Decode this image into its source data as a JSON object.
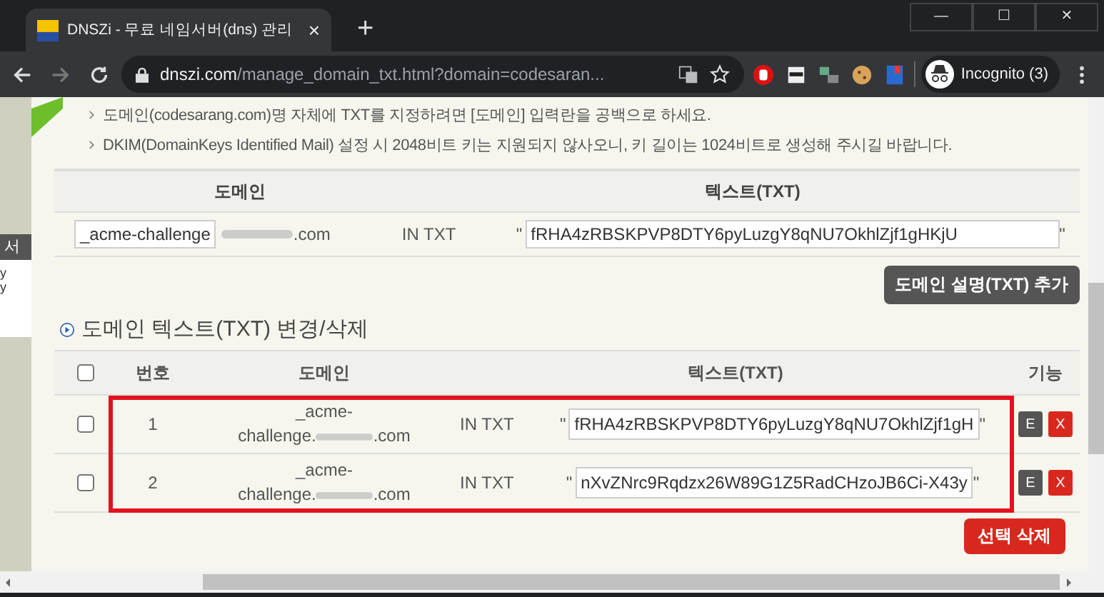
{
  "browser": {
    "tab_title": "DNSZi - 무료 네임서버(dns) 관리",
    "tab_close": "×",
    "new_tab": "+",
    "url_host": "dnszi.com",
    "url_path": "/manage_domain_txt.html?domain=codesaran...",
    "profile": "Incognito (3)",
    "window_buttons": [
      "—",
      "☐",
      "✕"
    ]
  },
  "side_fragment": {
    "label": "서",
    "lines": [
      "y",
      "y"
    ]
  },
  "notes": [
    "도메인(codesarang.com)명 자체에 TXT를 지정하려면 [도메인] 입력란을 공백으로 하세요.",
    "DKIM(DomainKeys Identified Mail) 설정 시 2048비트 키는 지원되지 않사오니, 키 길이는 1024비트로 생성해 주시길 바랍니다."
  ],
  "add_form": {
    "columns": [
      "도메인",
      "텍스트(TXT)"
    ],
    "domain_value": "_acme-challenge",
    "domain_suffix": ".com",
    "record_type": "IN TXT",
    "quote_open": "\"",
    "txt_value": "fRHA4zRBSKPVP8DTY6pyLuzgY8qNU7OkhlZjf1gHKjU",
    "quote_close": "\"",
    "add_button": "도메인 설명(TXT) 추가"
  },
  "section_title": "도메인 텍스트(TXT) 변경/삭제",
  "list": {
    "columns": [
      "번호",
      "도메인",
      "텍스트(TXT)",
      "기능"
    ],
    "select_all": false,
    "rows": [
      {
        "number": "1",
        "domain_prefix": "_acme-",
        "domain_name": "challenge.",
        "domain_suffix": ".com",
        "record_type": "IN TXT",
        "txt_value": "fRHA4zRBSKPVP8DTY6pyLuzgY8qNU7OkhlZjf1gH",
        "checked": false,
        "edit": "E",
        "delete": "X"
      },
      {
        "number": "2",
        "domain_prefix": "_acme-",
        "domain_name": "challenge.",
        "domain_suffix": ".com",
        "record_type": "IN TXT",
        "txt_value": "nXvZNrc9Rqdzx26W89G1Z5RadCHzoJB6Ci-X43y",
        "checked": false,
        "edit": "E",
        "delete": "X"
      }
    ],
    "highlighted": true,
    "delete_selected": "선택 삭제"
  }
}
